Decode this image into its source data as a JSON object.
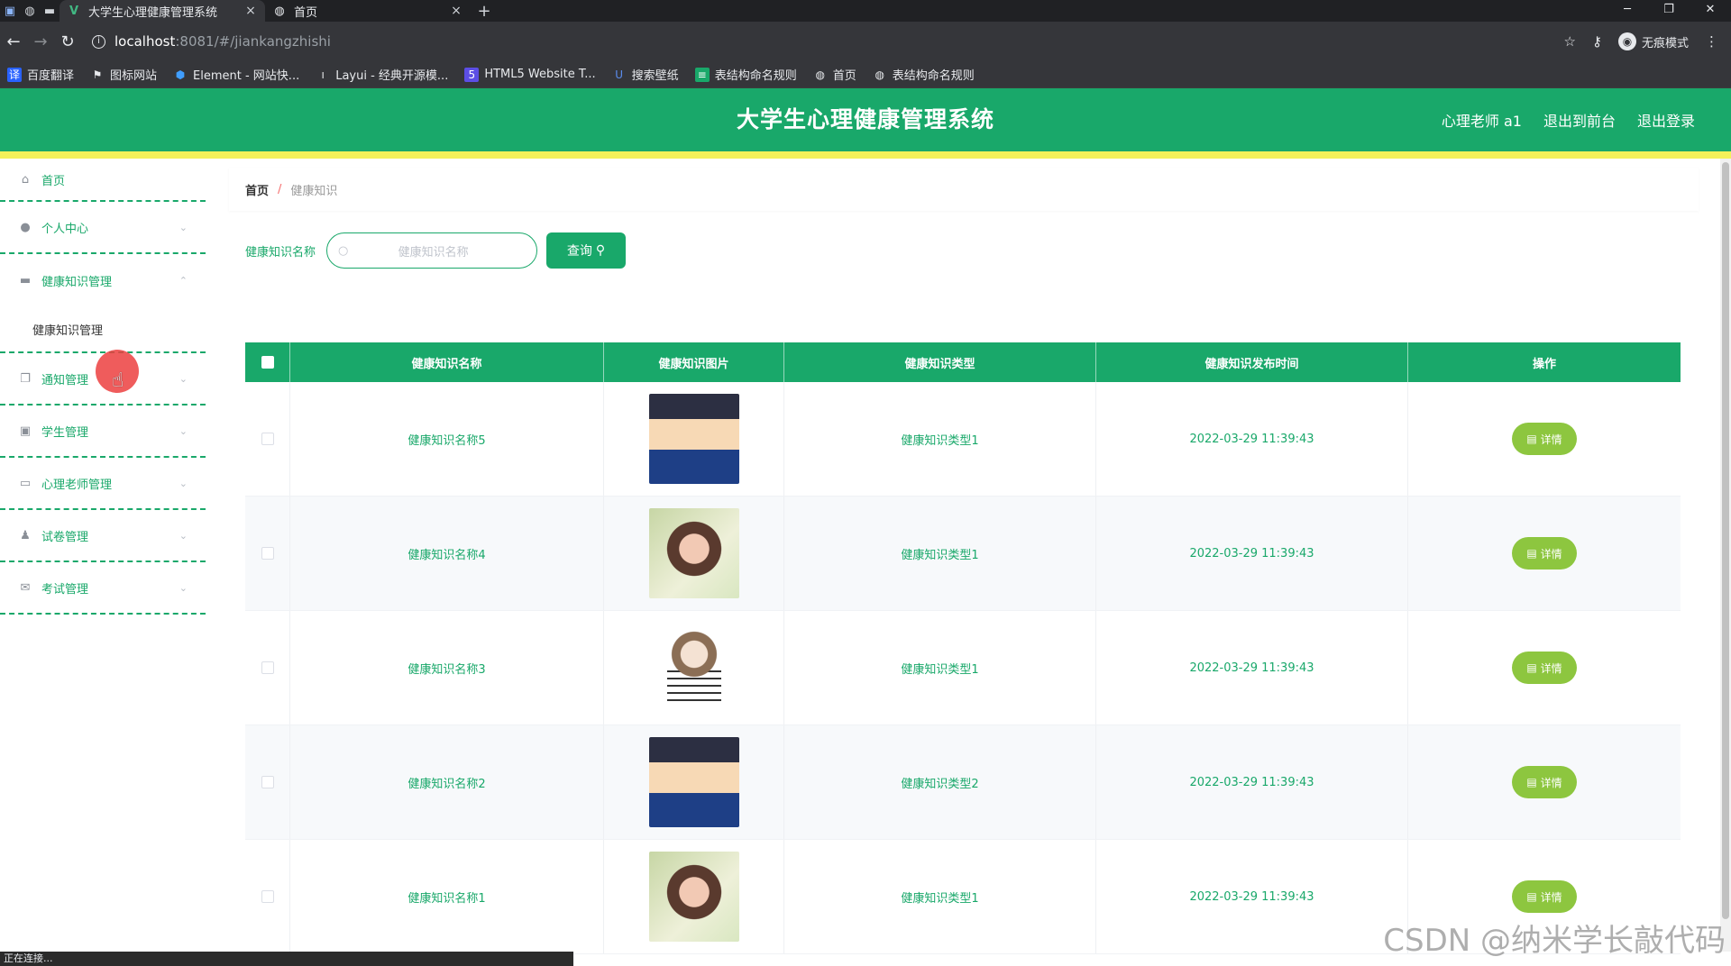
{
  "browser": {
    "tabs": [
      {
        "title": "大学生心理健康管理系统",
        "active": true
      },
      {
        "title": "首页",
        "active": false
      }
    ],
    "url_host": "localhost",
    "url_path": ":8081/#/jiankangzhishi",
    "incognito_label": "无痕模式",
    "bookmarks": [
      {
        "label": "百度翻译",
        "icon": "translate-icon"
      },
      {
        "label": "图标网站",
        "icon": "flag-icon"
      },
      {
        "label": "Element - 网站快...",
        "icon": "element-icon"
      },
      {
        "label": "Layui - 经典开源模...",
        "icon": "layui-icon"
      },
      {
        "label": "HTML5 Website T...",
        "icon": "html5-icon"
      },
      {
        "label": "搜索壁纸",
        "icon": "wallpaper-icon"
      },
      {
        "label": "表结构命名规则",
        "icon": "table-icon"
      },
      {
        "label": "首页",
        "icon": "globe-icon"
      },
      {
        "label": "表结构命名规则",
        "icon": "globe-icon"
      }
    ],
    "status_text": "正在连接..."
  },
  "header": {
    "title": "大学生心理健康管理系统",
    "user": "心理老师 a1",
    "front_link": "退出到前台",
    "logout_link": "退出登录",
    "brand_color": "#19a86a",
    "accent_strip": "#f3f15a"
  },
  "sidebar": {
    "items": [
      {
        "label": "首页",
        "icon": "home-icon"
      },
      {
        "label": "个人中心",
        "icon": "user-icon"
      },
      {
        "label": "健康知识管理",
        "icon": "monitor-icon",
        "expanded": true,
        "sub": "健康知识管理"
      },
      {
        "label": "通知管理",
        "icon": "copy-icon"
      },
      {
        "label": "学生管理",
        "icon": "clipboard-icon"
      },
      {
        "label": "心理老师管理",
        "icon": "chat-icon"
      },
      {
        "label": "试卷管理",
        "icon": "person-icon"
      },
      {
        "label": "考试管理",
        "icon": "mail-icon"
      }
    ]
  },
  "breadcrumb": {
    "home": "首页",
    "current": "健康知识"
  },
  "search": {
    "label": "健康知识名称",
    "placeholder": "健康知识名称",
    "button": "查询"
  },
  "table": {
    "headers": [
      "健康知识名称",
      "健康知识图片",
      "健康知识类型",
      "健康知识发布时间",
      "操作"
    ],
    "rows": [
      {
        "name": "健康知识名称5",
        "image": "conan",
        "type": "健康知识类型1",
        "time": "2022-03-29 11:39:43",
        "action": "详情"
      },
      {
        "name": "健康知识名称4",
        "image": "girl",
        "type": "健康知识类型1",
        "time": "2022-03-29 11:39:43",
        "action": "详情"
      },
      {
        "name": "健康知识名称3",
        "image": "sketch",
        "type": "健康知识类型1",
        "time": "2022-03-29 11:39:43",
        "action": "详情"
      },
      {
        "name": "健康知识名称2",
        "image": "conan",
        "type": "健康知识类型2",
        "time": "2022-03-29 11:39:43",
        "action": "详情"
      },
      {
        "name": "健康知识名称1",
        "image": "girl",
        "type": "健康知识类型1",
        "time": "2022-03-29 11:39:43",
        "action": "详情"
      }
    ]
  },
  "watermark": "CSDN @纳米学长敲代码"
}
